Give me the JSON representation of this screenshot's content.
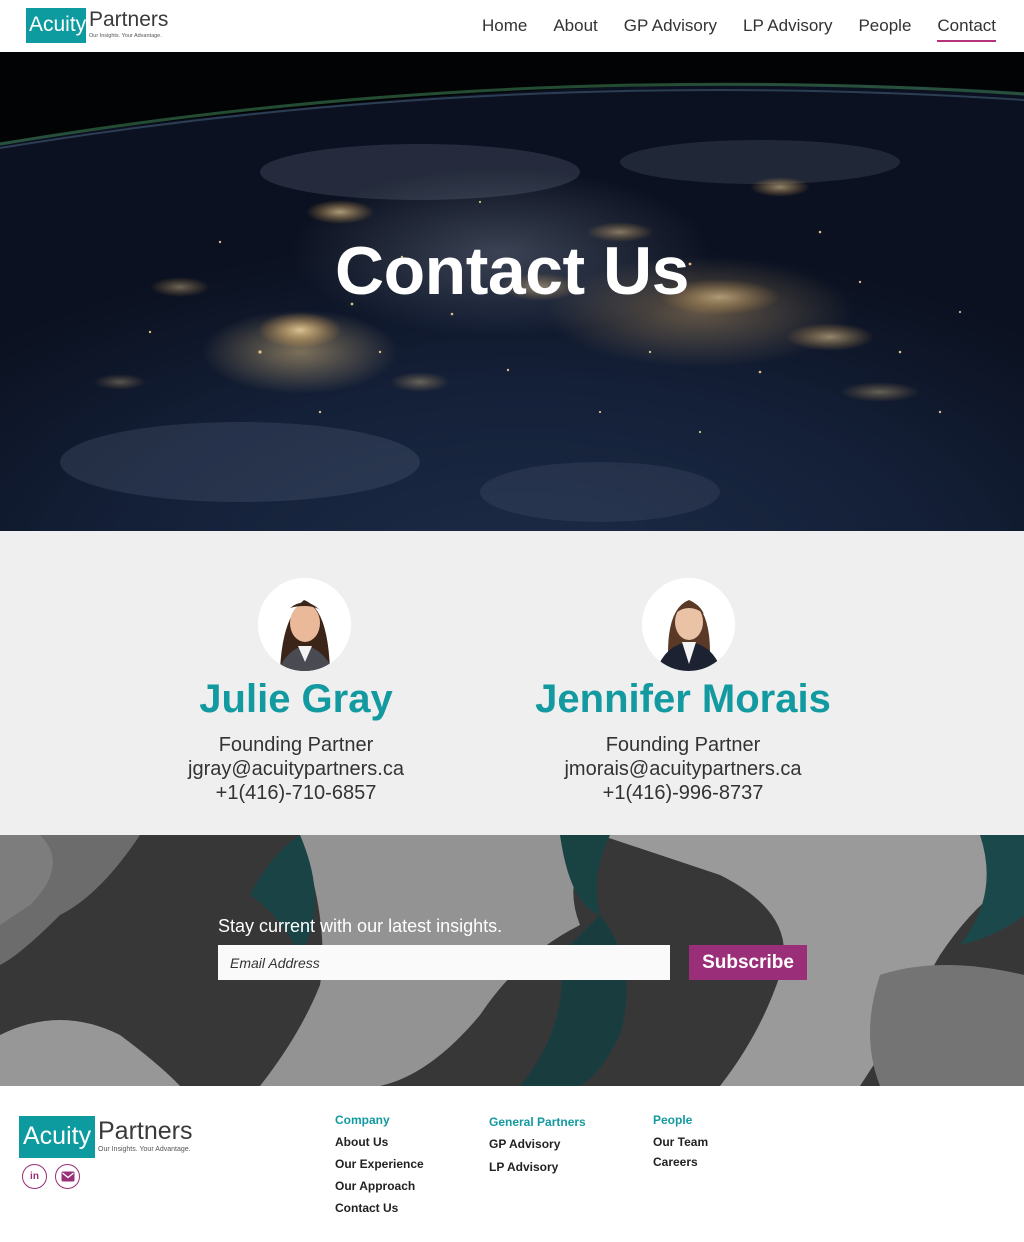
{
  "brand": {
    "logo_box": "Acuity",
    "logo_word": "Partners",
    "tagline": "Our Insights. Your Advantage."
  },
  "nav": {
    "items": [
      {
        "label": "Home"
      },
      {
        "label": "About"
      },
      {
        "label": "GP Advisory"
      },
      {
        "label": "LP Advisory"
      },
      {
        "label": "People"
      },
      {
        "label": "Contact",
        "active": true
      }
    ]
  },
  "hero": {
    "title": "Contact Us"
  },
  "contacts": [
    {
      "name": "Julie Gray",
      "role": "Founding Partner",
      "email": "jgray@acuitypartners.ca",
      "phone": "+1(416)-710-6857"
    },
    {
      "name": "Jennifer Morais",
      "role": "Founding Partner",
      "email": "jmorais@acuitypartners.ca",
      "phone": "+1(416)-996-8737"
    }
  ],
  "subscribe": {
    "text": "Stay current with our latest insights.",
    "placeholder": "Email Address",
    "button_label": "Subscribe"
  },
  "footer": {
    "social": [
      {
        "icon": "linkedin-icon",
        "label": "in"
      },
      {
        "icon": "mail-icon"
      }
    ],
    "columns": [
      {
        "heading": "Company",
        "links": [
          "About Us",
          "Our Experience",
          "Our Approach",
          "Contact Us"
        ]
      },
      {
        "heading": "General Partners",
        "links": [
          "GP Advisory",
          "LP Advisory"
        ]
      },
      {
        "heading": "People",
        "links": [
          "Our Team",
          "Careers"
        ]
      }
    ]
  },
  "colors": {
    "brand_teal": "#129aa0",
    "accent_magenta": "#9b2e78",
    "contacts_bg": "#efefef"
  }
}
